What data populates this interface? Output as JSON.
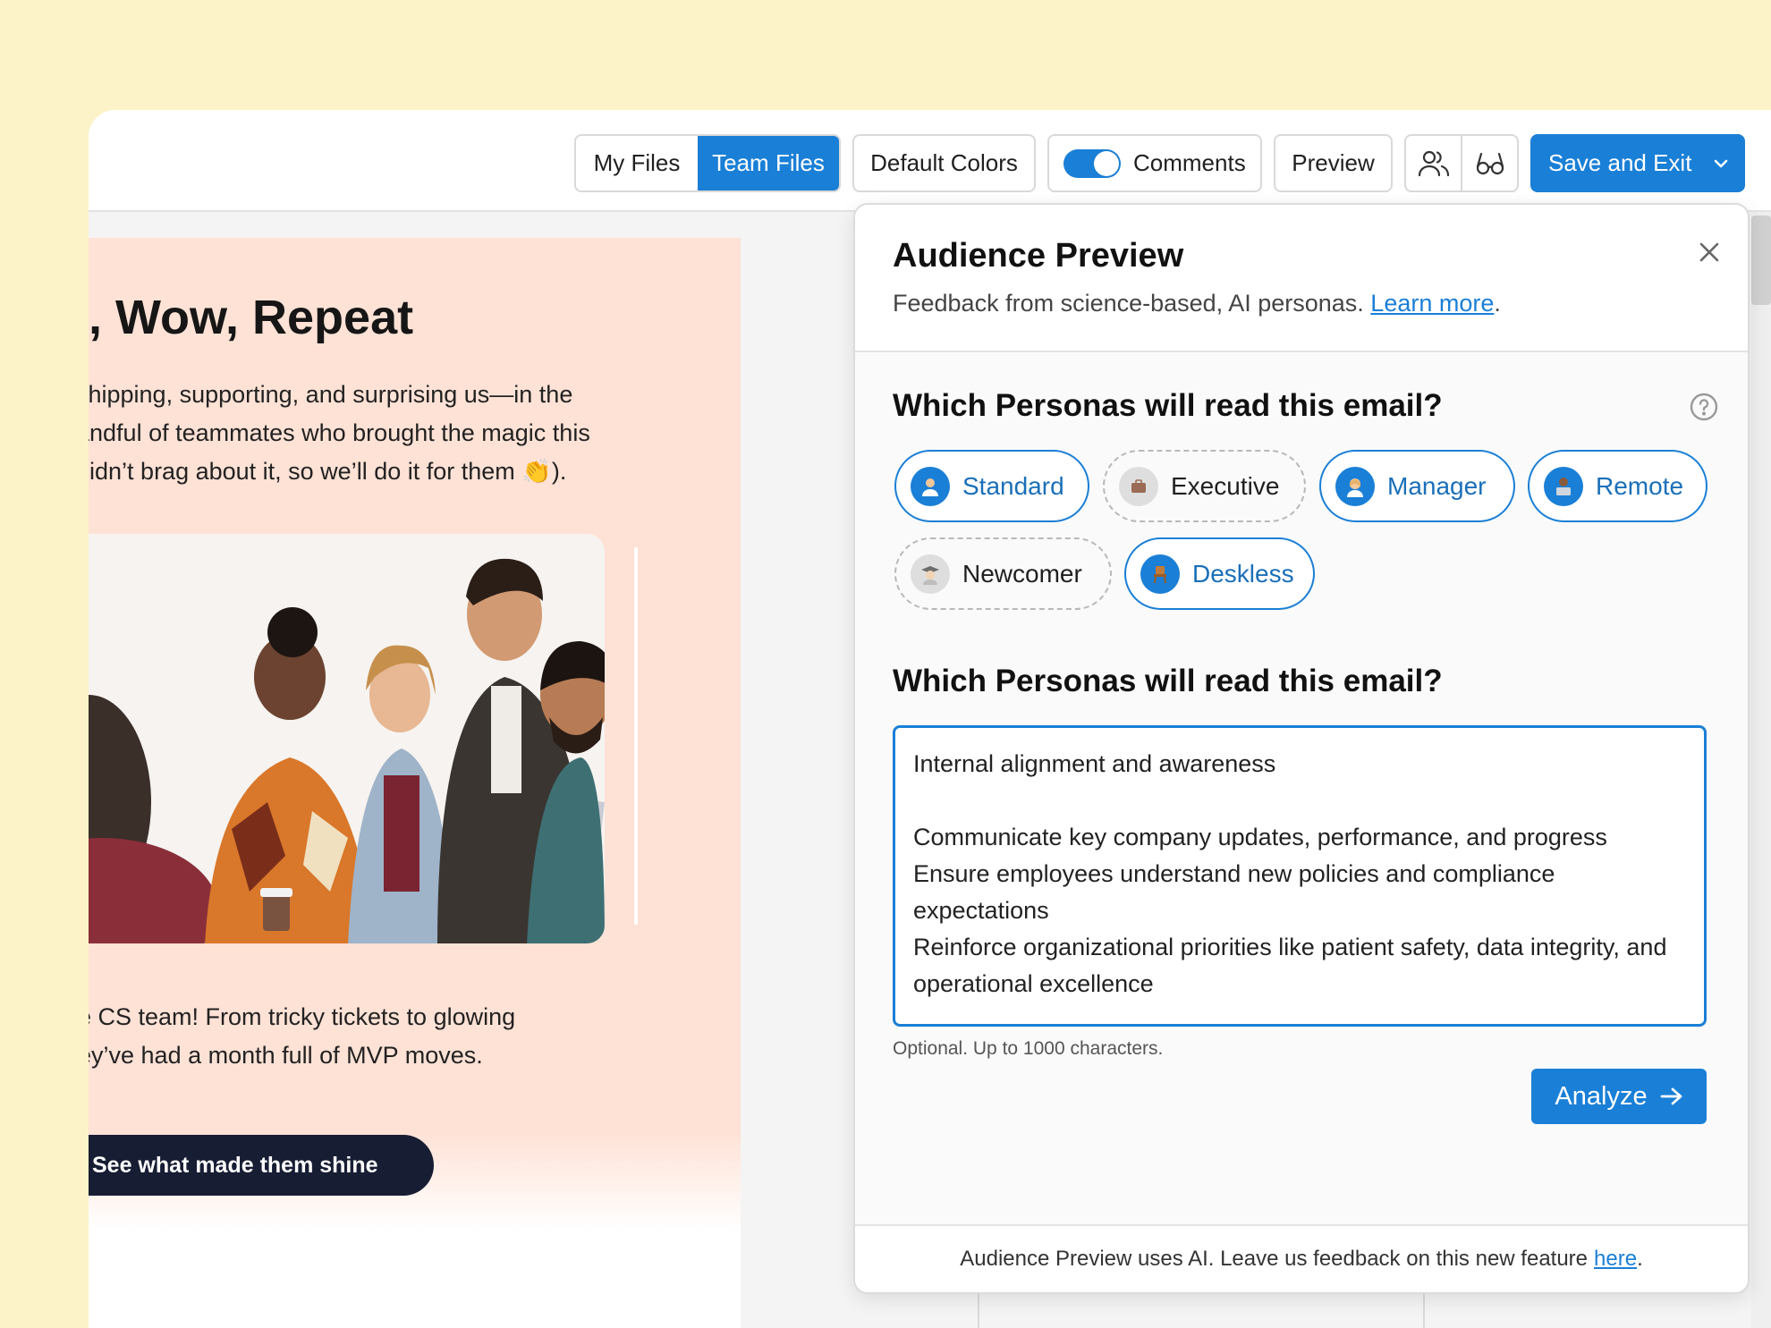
{
  "toolbar": {
    "my_files": "My Files",
    "team_files": "Team Files",
    "default_colors": "Default Colors",
    "comments": "Comments",
    "comments_enabled": true,
    "preview": "Preview",
    "save_and_exit": "Save and Exit"
  },
  "email": {
    "headline": "k, Wow, Repeat",
    "intro_lines": [
      "shipping, supporting, and surprising us—in the",
      "andful of teammates who brought the magic this",
      "didn’t brag about it, so we’ll do it for them 👏)."
    ],
    "body_lines": [
      "e CS team! From tricky tickets to glowing",
      "ey’ve had a month full of MVP moves."
    ],
    "cta": "See what made them shine"
  },
  "panel": {
    "title": "Audience Preview",
    "subtitle": "Feedback from science-based, AI personas.",
    "learn_more": "Learn more",
    "question_personas": "Which Personas will read this email?",
    "personas": [
      {
        "label": "Standard",
        "selected": true,
        "icon": "person-icon"
      },
      {
        "label": "Executive",
        "selected": false,
        "icon": "briefcase-icon"
      },
      {
        "label": "Manager",
        "selected": true,
        "icon": "person-icon"
      },
      {
        "label": "Remote",
        "selected": true,
        "icon": "laptop-icon"
      },
      {
        "label": "Newcomer",
        "selected": false,
        "icon": "graduate-icon"
      },
      {
        "label": "Deskless",
        "selected": true,
        "icon": "chair-icon"
      }
    ],
    "question_goals": "Which Personas will read this email?",
    "goals_text": "Internal alignment and awareness\n\nCommunicate key company updates, performance, and progress\nEnsure employees understand new policies and compliance expectations\nReinforce organizational priorities like patient safety, data integrity, and operational excellence",
    "hint": "Optional. Up to 1000 characters.",
    "analyze": "Analyze",
    "footer_text": "Audience Preview uses AI. Leave us feedback on this new feature",
    "footer_link": "here"
  },
  "colors": {
    "accent": "#1a7fd6",
    "background": "#fdf3c9",
    "email_bg": "#ffe2d6",
    "cta_bg": "#171d33"
  }
}
